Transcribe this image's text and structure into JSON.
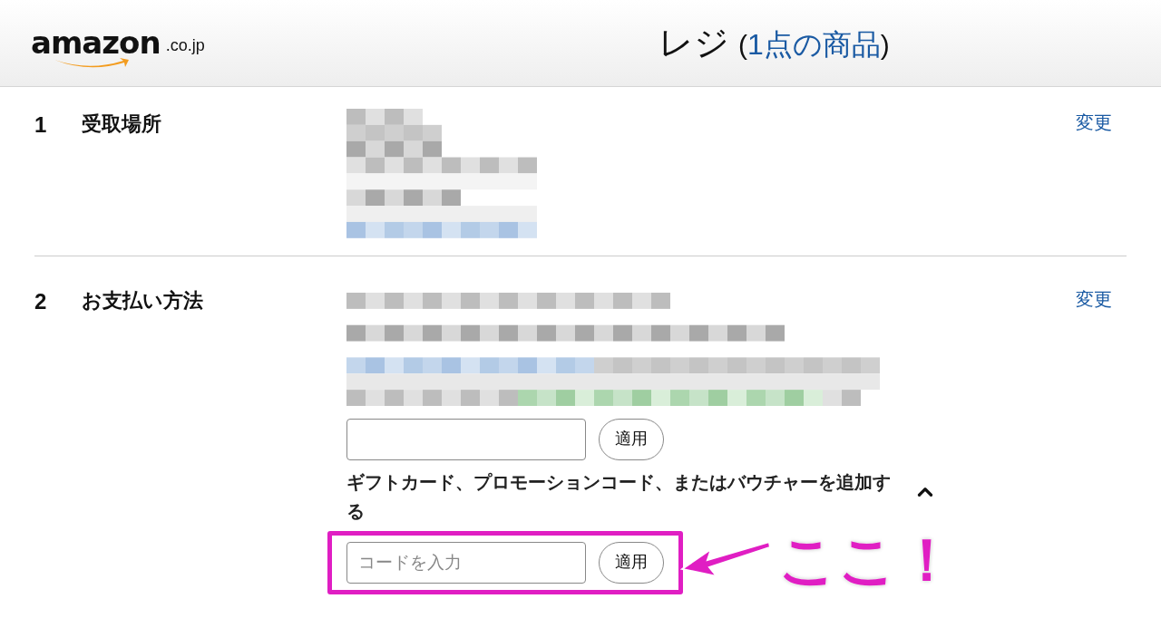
{
  "header": {
    "logo": {
      "wordmark": "amazon",
      "domain": ".co.jp"
    },
    "title": "レジ",
    "title_open": "(",
    "item_count": "1点の商品",
    "title_close": ")"
  },
  "sections": [
    {
      "kind": "address",
      "number": "1",
      "label": "受取場所",
      "change_link": "変更"
    },
    {
      "kind": "payment",
      "number": "2",
      "label": "お支払い方法",
      "change_link": "変更",
      "code_rows": [
        {
          "button": "適用",
          "highlighted": false
        }
      ],
      "promo_toggle": {
        "text": "ギフトカード、プロモーションコード、またはバウチャーを追加する",
        "expanded": true
      },
      "expanded_rows": [
        {
          "placeholder": "コードを入力",
          "button": "適用",
          "highlighted": true
        }
      ]
    }
  ],
  "annotation": {
    "text": "ここ！"
  }
}
